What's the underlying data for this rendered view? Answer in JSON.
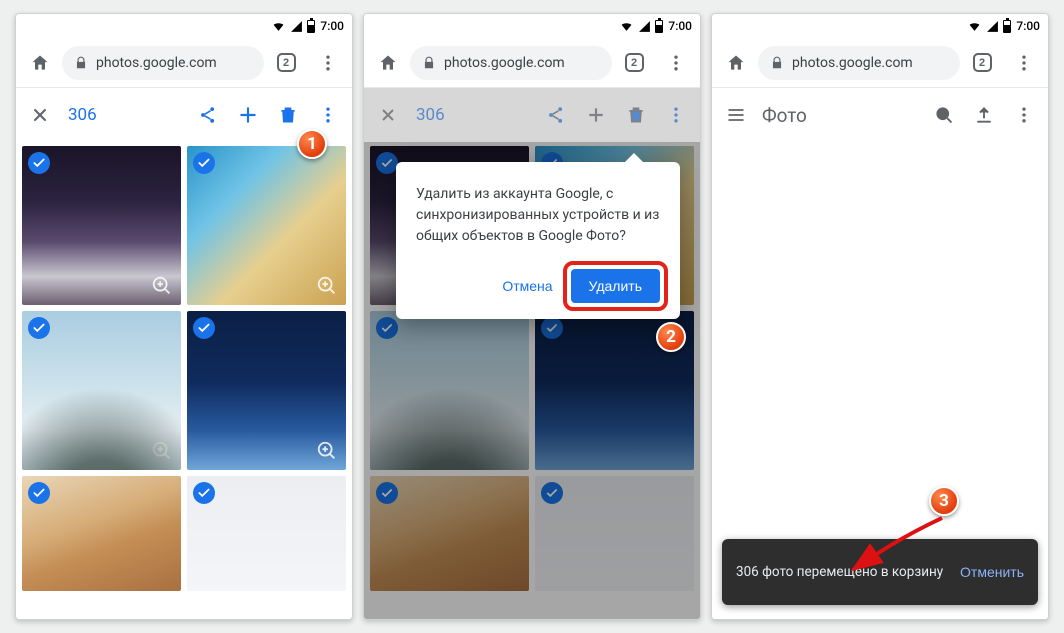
{
  "status": {
    "time": "7:00"
  },
  "browser": {
    "url": "photos.google.com",
    "tab_count": "2"
  },
  "selection_bar": {
    "count": "306"
  },
  "photos_bar": {
    "title": "Фото"
  },
  "dialog": {
    "message": "Удалить из аккаунта Google, с синхронизированных устройств и из общих объектов в Google Фото?",
    "cancel": "Отмена",
    "confirm": "Удалить"
  },
  "toast": {
    "message": "306 фото перемещено в корзину",
    "undo": "Отменить"
  },
  "markers": {
    "m1": "1",
    "m2": "2",
    "m3": "3"
  }
}
